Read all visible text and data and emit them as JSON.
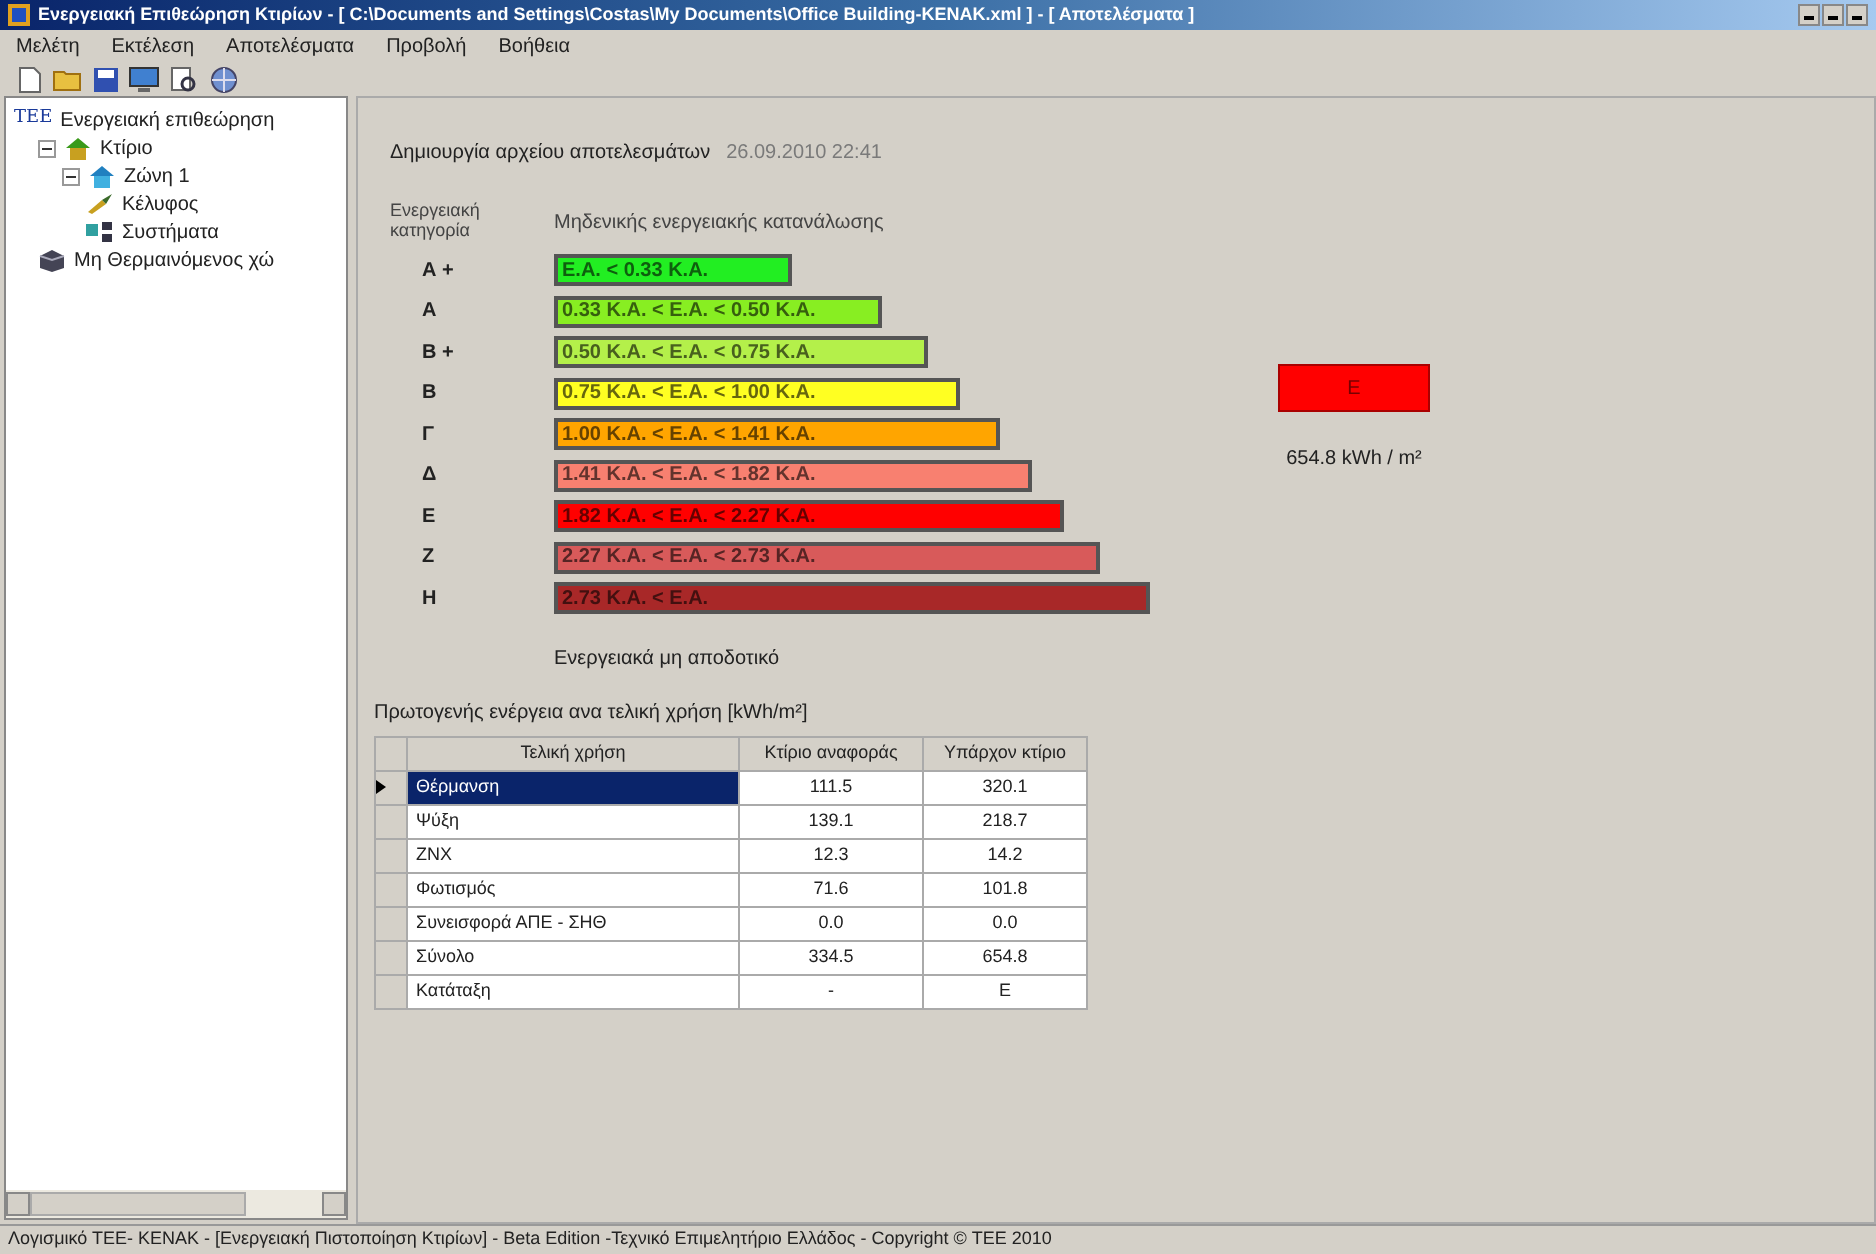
{
  "window": {
    "title": "Ενεργειακή Επιθεώρηση Κτιρίων - [ C:\\Documents and Settings\\Costas\\My Documents\\Office Building-KENAK.xml ] - [ Αποτελέσματα ]"
  },
  "menu": [
    "Μελέτη",
    "Εκτέλεση",
    "Αποτελέσματα",
    "Προβολή",
    "Βοήθεια"
  ],
  "tree": [
    {
      "label": "Ενεργειακή επιθεώρηση",
      "kind": "tee",
      "children": [
        {
          "label": "Κτίριο",
          "kind": "building",
          "expanded": true,
          "children": [
            {
              "label": "Ζώνη 1",
              "kind": "zone",
              "expanded": true,
              "children": [
                {
                  "label": "Κέλυφος",
                  "kind": "shell"
                },
                {
                  "label": "Συστήματα",
                  "kind": "systems"
                }
              ]
            }
          ]
        },
        {
          "label": "Μη Θερμαινόμενος χώ",
          "kind": "unheated"
        }
      ]
    }
  ],
  "tree_prefix": "ΤΕΕ",
  "results": {
    "created_label": "Δημιουργία αρχείου αποτελεσμάτων",
    "created_date": "26.09.2010 22:41",
    "category_label": "Ενεργειακή κατηγορία",
    "top_label": "Μηδενικής ενεργειακής κατανάλωσης",
    "bottom_label": "Ενεργειακά μη αποδοτικό",
    "bands": [
      {
        "grade": "Α +",
        "range": "Ε.Α. < 0.33 Κ.Α.",
        "color": "#22ee22"
      },
      {
        "grade": "Α",
        "range": "0.33 Κ.Α. < Ε.Α. < 0.50 Κ.Α.",
        "color": "#88ee22"
      },
      {
        "grade": "Β +",
        "range": "0.50 Κ.Α. < Ε.Α. < 0.75 Κ.Α.",
        "color": "#b4f04a"
      },
      {
        "grade": "Β",
        "range": "0.75 Κ.Α. < Ε.Α. < 1.00 Κ.Α.",
        "color": "#ffff22"
      },
      {
        "grade": "Γ",
        "range": "1.00 Κ.Α. < Ε.Α. < 1.41 Κ.Α.",
        "color": "#ffa500"
      },
      {
        "grade": "Δ",
        "range": "1.41 Κ.Α. < Ε.Α. < 1.82 Κ.Α.",
        "color": "#f88070"
      },
      {
        "grade": "Ε",
        "range": "1.82 Κ.Α. < Ε.Α. < 2.27 Κ.Α.",
        "color": "#ff0000"
      },
      {
        "grade": "Ζ",
        "range": "2.27 Κ.Α. < Ε.Α. < 2.73 Κ.Α.",
        "color": "#d85a5a"
      },
      {
        "grade": "Η",
        "range": "2.73 Κ.Α. < Ε.Α.",
        "color": "#a82828"
      }
    ],
    "indicator": {
      "grade": "Ε",
      "color": "#ff0000",
      "value": "654.8 kWh / m²"
    },
    "table_title": "Πρωτογενής ενέργεια ανα τελική χρήση [kWh/m²]",
    "table": {
      "columns": [
        "Τελική χρήση",
        "Κτίριο αναφοράς",
        "Υπάρχον κτίριο"
      ],
      "rows": [
        {
          "cells": [
            "Θέρμανση",
            "111.5",
            "320.1"
          ],
          "selected": true
        },
        {
          "cells": [
            "Ψύξη",
            "139.1",
            "218.7"
          ],
          "selected": false
        },
        {
          "cells": [
            "ΖΝΧ",
            "12.3",
            "14.2"
          ],
          "selected": false
        },
        {
          "cells": [
            "Φωτισμός",
            "71.6",
            "101.8"
          ],
          "selected": false
        },
        {
          "cells": [
            "Συνεισφορά ΑΠΕ - ΣΗΘ",
            "0.0",
            "0.0"
          ],
          "selected": false
        },
        {
          "cells": [
            "Σύνολο",
            "334.5",
            "654.8"
          ],
          "selected": false
        },
        {
          "cells": [
            "Κατάταξη",
            "-",
            "Ε"
          ],
          "selected": false
        }
      ]
    }
  },
  "status_bar": "Λογισμικό ΤΕΕ- ΚΕΝΑΚ - [Ενεργειακή Πιστοποίηση Κτιρίων] - Beta Edition -Τεχνικό Επιμελητήριο Ελλάδος - Copyright © ΤΕΕ 2010"
}
